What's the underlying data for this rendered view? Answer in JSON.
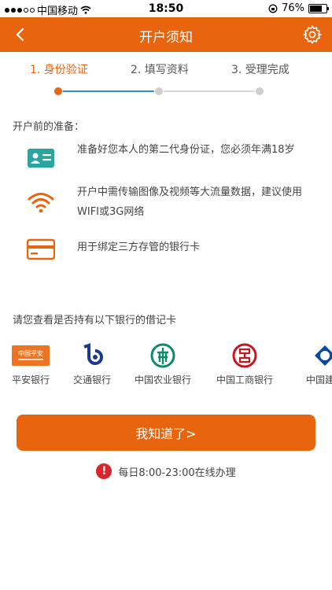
{
  "status_bar": {
    "carrier": "中国移动",
    "time": "18:50",
    "battery": "76%",
    "battery_level": 0.76
  },
  "header": {
    "title": "开户须知"
  },
  "steps": [
    {
      "label": "1. 身份验证",
      "active": true
    },
    {
      "label": "2. 填写资料",
      "active": false
    },
    {
      "label": "3. 受理完成",
      "active": false
    }
  ],
  "preparation": {
    "title": "开户前的准备：",
    "items": [
      {
        "icon": "id-card-icon",
        "text": "准备好您本人的第二代身份证，您必须年满18岁"
      },
      {
        "icon": "wifi-icon",
        "text": "开户中需传输图像及视频等大流量数据，建议使用WIFI或3G网络"
      },
      {
        "icon": "bank-card-icon",
        "text": "用于绑定三方存管的银行卡"
      }
    ]
  },
  "banks": {
    "title": "请您查看是否持有以下银行的借记卡",
    "items": [
      {
        "name": "平安银行",
        "logo_text": "中国平安"
      },
      {
        "name": "交通银行"
      },
      {
        "name": "中国农业银行"
      },
      {
        "name": "中国工商银行"
      },
      {
        "name": "中国建设"
      }
    ]
  },
  "confirm_button": "我知道了>",
  "hours_notice": "每日8:00-23:00在线办理",
  "colors": {
    "accent": "#e8640f",
    "step_line": "#2a8fd6",
    "icon_teal": "#27a7a0"
  }
}
